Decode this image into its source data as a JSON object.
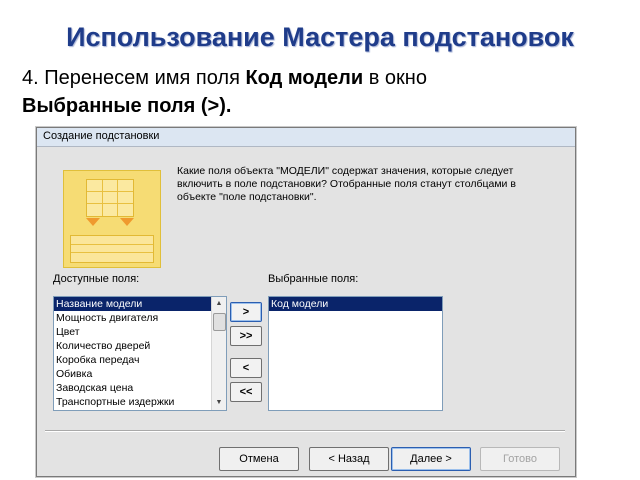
{
  "slide": {
    "title": "Использование Мастера подстановок",
    "instruction_part1": "4. Перенесем имя поля ",
    "instruction_bold1": "Код модели",
    "instruction_part2": " в окно",
    "instruction_bold2": "Выбранные поля (>)."
  },
  "dialog": {
    "title": "Создание подстановки",
    "description": "Какие поля объекта \"МОДЕЛИ\" содержат значения, которые следует включить в поле подстановки? Отобранные поля станут столбцами в объекте \"поле подстановки\".",
    "available_label": "Доступные поля:",
    "selected_label": "Выбранные поля:",
    "available_fields": [
      "Название модели",
      "Мощность двигателя",
      "Цвет",
      "Количество дверей",
      "Коробка передач",
      "Обивка",
      "Заводская цена",
      "Транспортные издержки"
    ],
    "selected_fields": [
      "Код модели"
    ],
    "move_buttons": {
      "add_one": ">",
      "add_all": ">>",
      "remove_one": "<",
      "remove_all": "<<"
    },
    "buttons": {
      "cancel": "Отмена",
      "back": "< Назад",
      "next": "Далее >",
      "finish": "Готово"
    },
    "icons": {
      "scroll_up": "scroll-up-icon",
      "scroll_down": "scroll-down-icon",
      "illustration": "lookup-wizard-icon"
    }
  },
  "colors": {
    "title": "#1f3c8a",
    "selection": "#0a246a",
    "illustration": "#f6dc74"
  }
}
